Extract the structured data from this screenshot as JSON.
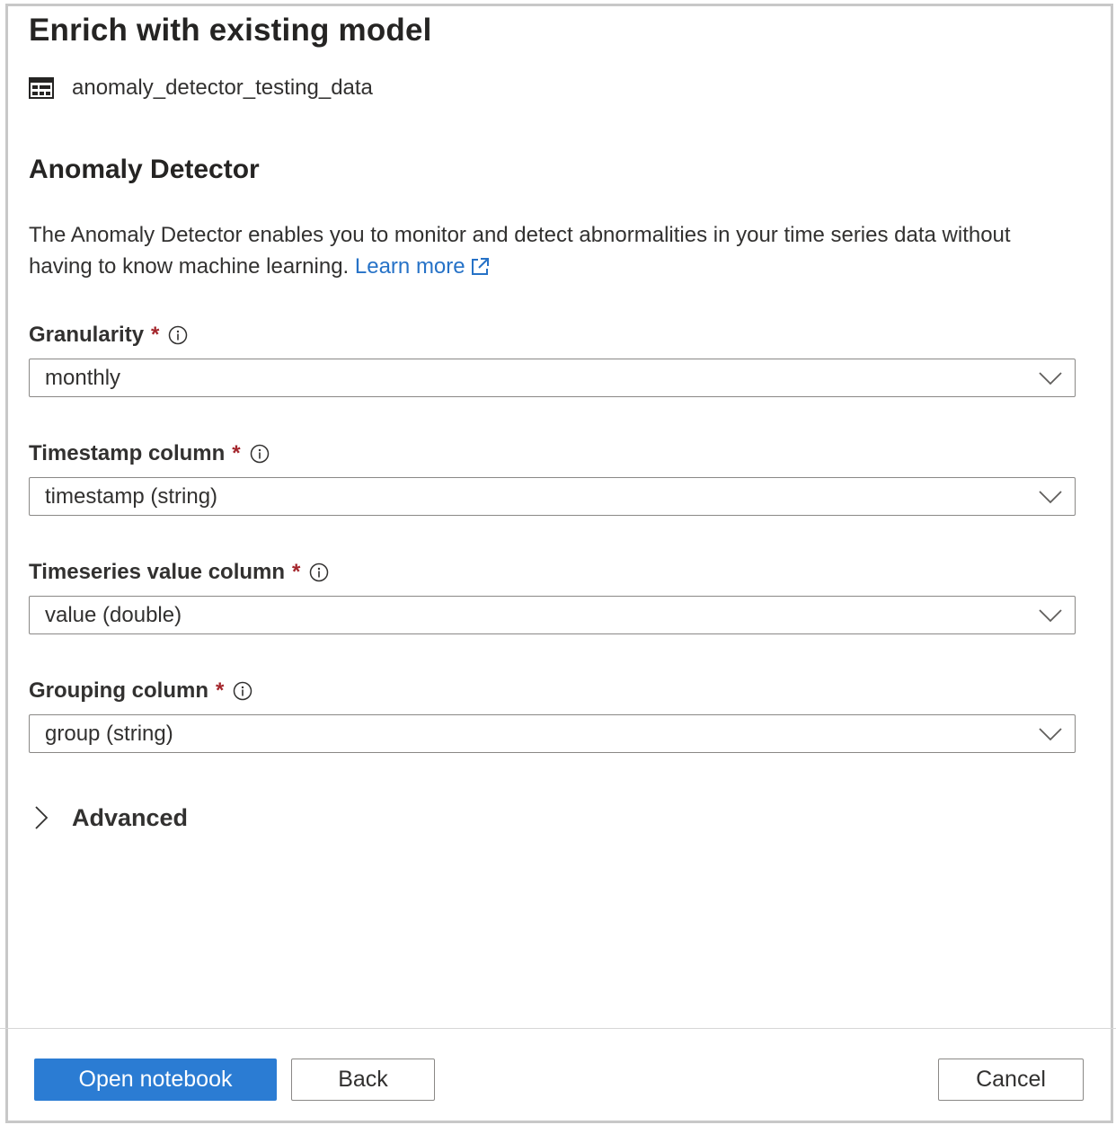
{
  "panel": {
    "title": "Enrich with existing model",
    "dataset_name": "anomaly_detector_testing_data"
  },
  "section": {
    "title": "Anomaly Detector",
    "description": "The Anomaly Detector enables you to monitor and detect abnormalities in your time series data without having to know machine learning.",
    "learn_more_label": "Learn more"
  },
  "fields": [
    {
      "label": "Granularity",
      "required_mark": "*",
      "value": "monthly"
    },
    {
      "label": "Timestamp column",
      "required_mark": "*",
      "value": "timestamp (string)"
    },
    {
      "label": "Timeseries value column",
      "required_mark": "*",
      "value": "value (double)"
    },
    {
      "label": "Grouping column",
      "required_mark": "*",
      "value": "group (string)"
    }
  ],
  "advanced": {
    "label": "Advanced",
    "icon": "chevron-right-icon",
    "expanded": false
  },
  "footer": {
    "open_notebook_label": "Open notebook",
    "back_label": "Back",
    "cancel_label": "Cancel"
  },
  "colors": {
    "primary": "#2b7cd3",
    "link": "#2672c7",
    "required": "#a4262c",
    "border": "#8a8886"
  }
}
